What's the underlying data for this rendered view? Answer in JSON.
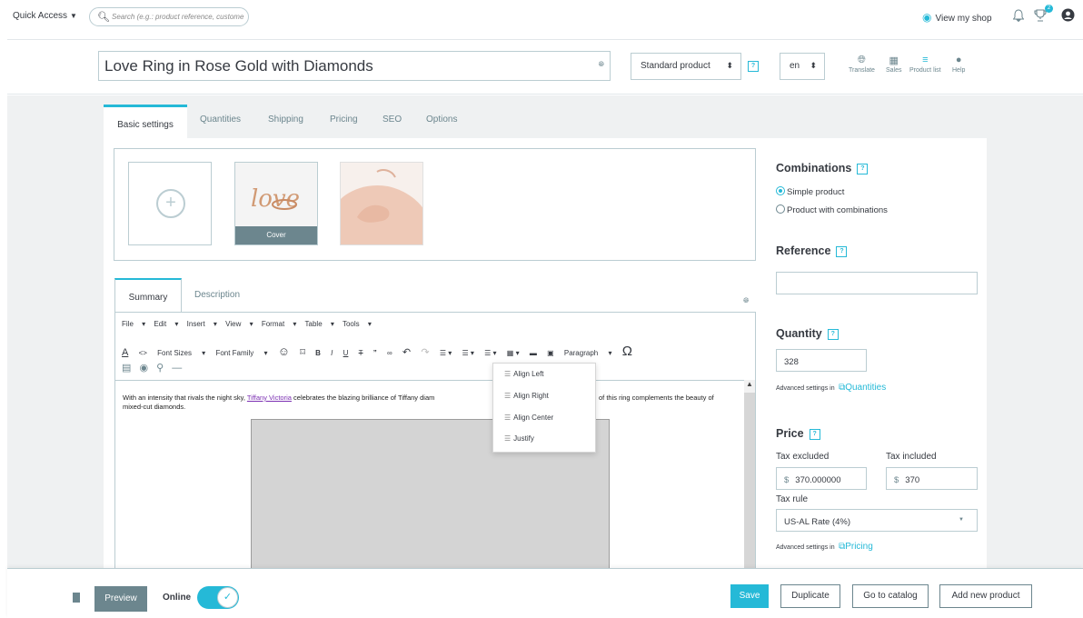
{
  "topbar": {
    "quick_access": "Quick Access",
    "search_placeholder": "Search (e.g.: product reference, custome",
    "view_shop": "View my shop",
    "trophy_badge": "2"
  },
  "header": {
    "product_name": "Love Ring in Rose Gold with Diamonds",
    "product_type": "Standard product",
    "lang": "en",
    "tools": {
      "translate": "Translate",
      "sales": "Sales",
      "product_list": "Product list",
      "help": "Help"
    }
  },
  "tabs": [
    "Basic settings",
    "Quantities",
    "Shipping",
    "Pricing",
    "SEO",
    "Options"
  ],
  "images": {
    "cover_label": "Cover",
    "cover_image_text": "love"
  },
  "editor": {
    "tabs": [
      "Summary",
      "Description"
    ],
    "menus": [
      "File",
      "Edit",
      "Insert",
      "View",
      "Format",
      "Table",
      "Tools"
    ],
    "font_sizes": "Font Sizes",
    "font_family": "Font Family",
    "paragraph": "Paragraph",
    "text_before": "With an intensity that rivals the night sky, ",
    "text_link": "Tiffany Victoria",
    "text_after": " celebrates the blazing brilliance of Tiffany diam",
    "text_right": "of this ring complements the beauty of",
    "text_line2": "mixed-cut diamonds.",
    "align_menu": [
      "Align Left",
      "Align Right",
      "Align Center",
      "Justify"
    ]
  },
  "combinations": {
    "heading": "Combinations",
    "options": [
      "Simple product",
      "Product with combinations"
    ],
    "selected": "Simple product"
  },
  "reference": {
    "heading": "Reference",
    "value": ""
  },
  "quantity": {
    "heading": "Quantity",
    "value": "328",
    "advanced_text": "Advanced settings in",
    "advanced_link": "Quantities"
  },
  "price": {
    "heading": "Price",
    "tax_excluded_label": "Tax excluded",
    "tax_included_label": "Tax included",
    "currency": "$",
    "tax_excluded_value": "370.000000",
    "tax_included_value": "370",
    "tax_rule_label": "Tax rule",
    "tax_rule_value": "US-AL Rate (4%)",
    "advanced_text": "Advanced settings in",
    "advanced_link": "Pricing"
  },
  "footer": {
    "preview": "Preview",
    "online": "Online",
    "save": "Save",
    "duplicate": "Duplicate",
    "go_to_catalog": "Go to catalog",
    "add_new_product": "Add new product"
  },
  "colors": {
    "accent": "#25b9d7",
    "text": "#363a41",
    "muted": "#6c868e",
    "border": "#bbcdd2",
    "page_bg": "#eff1f2"
  }
}
